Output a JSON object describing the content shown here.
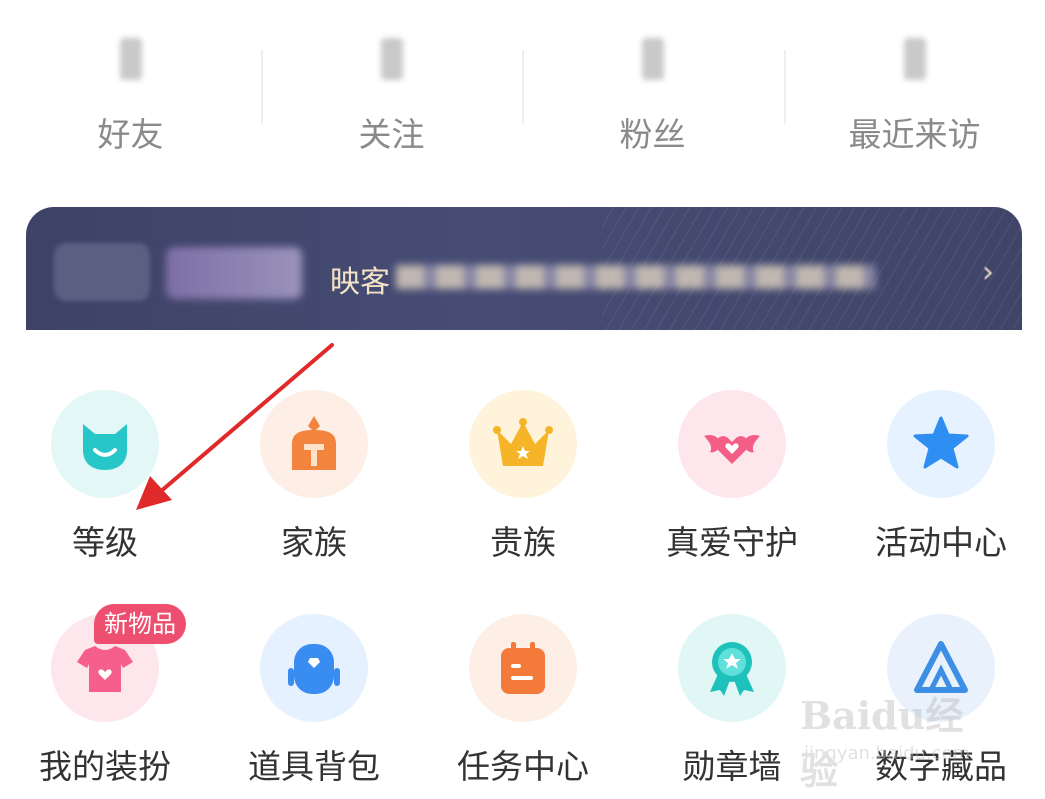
{
  "stats": [
    {
      "label": "好友"
    },
    {
      "label": "关注"
    },
    {
      "label": "粉丝"
    },
    {
      "label": "最近来访"
    }
  ],
  "vip_banner": {
    "prefix": "映客"
  },
  "grid": {
    "items": [
      {
        "label": "等级",
        "icon": "level-cat-icon",
        "bg": "#e3f7f7",
        "color": "#27c6c9"
      },
      {
        "label": "家族",
        "icon": "family-helmet-icon",
        "bg": "#fdeee6",
        "color": "#f2843e"
      },
      {
        "label": "贵族",
        "icon": "crown-icon",
        "bg": "#fff3dc",
        "color": "#f6b428"
      },
      {
        "label": "真爱守护",
        "icon": "winged-heart-icon",
        "bg": "#fde6ec",
        "color": "#f35d86"
      },
      {
        "label": "活动中心",
        "icon": "star-icon",
        "bg": "#e6f2ff",
        "color": "#2f8ef2"
      },
      {
        "label": "我的装扮",
        "icon": "tshirt-icon",
        "bg": "#fde6ec",
        "color": "#f65e8b"
      },
      {
        "label": "道具背包",
        "icon": "backpack-icon",
        "bg": "#e6f1ff",
        "color": "#3a8df0"
      },
      {
        "label": "任务中心",
        "icon": "calendar-icon",
        "bg": "#fdeee6",
        "color": "#f47a3a"
      },
      {
        "label": "勋章墙",
        "icon": "medal-icon",
        "bg": "#e1f7f5",
        "color": "#1fc2bb"
      },
      {
        "label": "数字藏品",
        "icon": "digital-collectible-icon",
        "bg": "#e8f1fc",
        "color": "#3d8fe6"
      }
    ],
    "new_badge": "新物品"
  },
  "watermark": {
    "main": "Baidu经验",
    "sub": "jingyan.baidu.com"
  },
  "annotation": {
    "color": "#e02a2a"
  }
}
